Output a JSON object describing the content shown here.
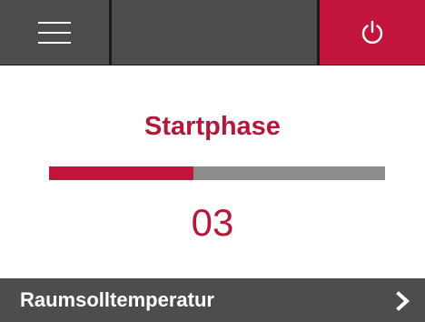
{
  "topbar": {
    "menu_icon": "hamburger-menu-icon",
    "power_icon": "power-icon",
    "power_color": "#c3153b",
    "bar_color": "#4d4d4d"
  },
  "status": {
    "title": "Startphase",
    "title_color": "#b5173a",
    "progress_fraction": 0.43,
    "counter": "03"
  },
  "bottom": {
    "label": "Raumsolltemperatur",
    "chevron_icon": "chevron-right-icon"
  }
}
